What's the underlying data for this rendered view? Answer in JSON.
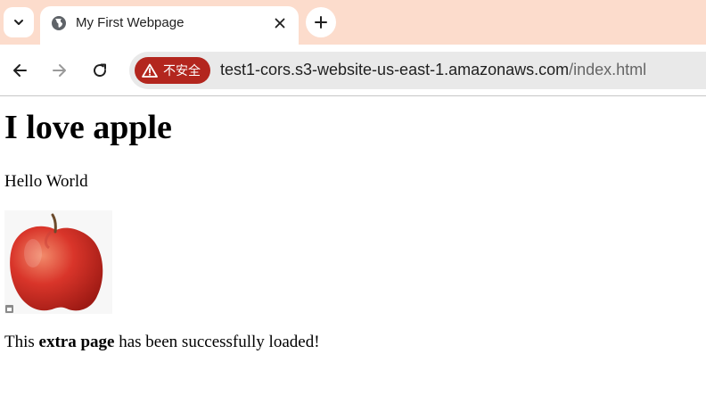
{
  "browser": {
    "tab": {
      "title": "My First Webpage"
    },
    "address_bar": {
      "security_label": "不安全",
      "url_host": "test1-cors.s3-website-us-east-1.amazonaws.com",
      "url_path": "/index.html"
    },
    "colors": {
      "tab_strip": "#fcdccc",
      "security_chip": "#b3261e"
    }
  },
  "page": {
    "heading": "I love apple",
    "paragraph": "Hello World",
    "status": {
      "prefix": "This ",
      "bold": "extra page",
      "suffix": " has been successfully loaded!"
    }
  }
}
